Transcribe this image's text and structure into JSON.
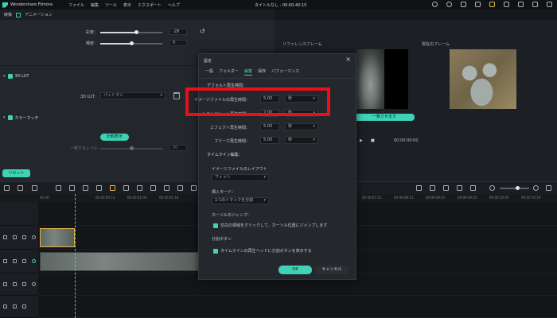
{
  "app": {
    "name": "Wondershare Filmora",
    "menu": [
      "ファイル",
      "編集",
      "ツール",
      "表示",
      "エクスポート",
      "ヘルプ"
    ],
    "window_title": "タイトルなし : 00:00:40:15"
  },
  "tabs": {
    "video": "映像",
    "animation": "アニメーション"
  },
  "left_panel": {
    "slider1_label": "彩度：",
    "slider1_value": "-28",
    "slider1_fill": 0.58,
    "slider2_label": "輝度：",
    "slider2_value": "0",
    "slider2_fill": 0.5,
    "lut_section": "3D LUT",
    "lut_label": "3D LUT：",
    "lut_value": "バットマン",
    "color_match_section": "カラーマッチ",
    "compare_button": "比較表示",
    "match_level_label": "一致するレベル：",
    "match_level_value": "50",
    "reset_button": "リセット"
  },
  "preview": {
    "reference_label": "リファレンスフレーム",
    "preview_label": "現在のフレーム",
    "match_button": "一致させます",
    "timecode": "00:00:00:00"
  },
  "timeline": {
    "ruler_ticks": [
      "00:00",
      "00:00:00:14",
      "00:00:01:04",
      "00:00:01:18",
      "00:00:02:08",
      "00:00:02:22",
      "00:00:03:12"
    ],
    "ruler_ticks_right": [
      "00:00:07:21",
      "00:00:08:11",
      "00:00:09:01",
      "00:00:09:15",
      "00:00:10:05",
      "00:00:10:19",
      "00:00:11:09"
    ]
  },
  "dialog": {
    "title": "設定",
    "close": "×",
    "tabs": [
      "一般",
      "フォルダー",
      "編集",
      "保存",
      "パフォーマンス"
    ],
    "active_tab_index": 2,
    "section_duration": "デフォルト再生時間：",
    "row_image_label": "イメージファイルの再生時間：",
    "row_image_value": "5.00",
    "row_image_unit": "秒",
    "row_transition_label": "トランジション再生時間：",
    "row_transition_value": "2.00",
    "row_transition_unit": "秒",
    "row_effect_label": "エフェクト再生時間：",
    "row_effect_value": "5.00",
    "row_effect_unit": "秒",
    "row_freeze_label": "フリーズ再生時間：",
    "row_freeze_value": "5.00",
    "row_freeze_unit": "秒",
    "section_timeline": "タイムライン編集：",
    "image_layout_label": "イメージファイルのレイアウト",
    "image_layout_value": "フィット",
    "insert_mode_label": "挿入モード：",
    "insert_mode_value": "1つのトラックを分割",
    "cursor_jump_label": "カーソルのジャンプ：",
    "cursor_jump_check": "空白の領域をクリックして、カーソル位置にジャンプします",
    "split_button_label": "分割ボタン",
    "split_button_check": "タイムラインの再生ヘッドに分割ボタンを表示する",
    "ok": "OK",
    "cancel": "キャンセル"
  },
  "colors": {
    "accent": "#3fd2b5",
    "highlight": "#e8101a",
    "background": "#15181d"
  }
}
